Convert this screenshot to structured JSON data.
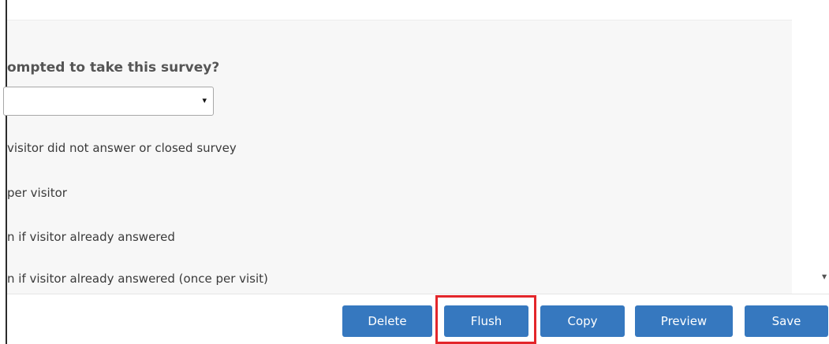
{
  "question": "ompted to take this survey?",
  "select": {
    "value": "",
    "arrow": "▾"
  },
  "options": [
    "visitor did not answer or closed survey",
    "per visitor",
    "n if visitor already answered",
    "n if visitor already answered (once per visit)"
  ],
  "buttons": {
    "delete": "Delete",
    "flush": "Flush",
    "copy": "Copy",
    "preview": "Preview",
    "save": "Save"
  },
  "scrollbar": {
    "down_arrow": "▼"
  },
  "colors": {
    "button_bg": "#3678bf",
    "highlight": "#e3262b"
  }
}
